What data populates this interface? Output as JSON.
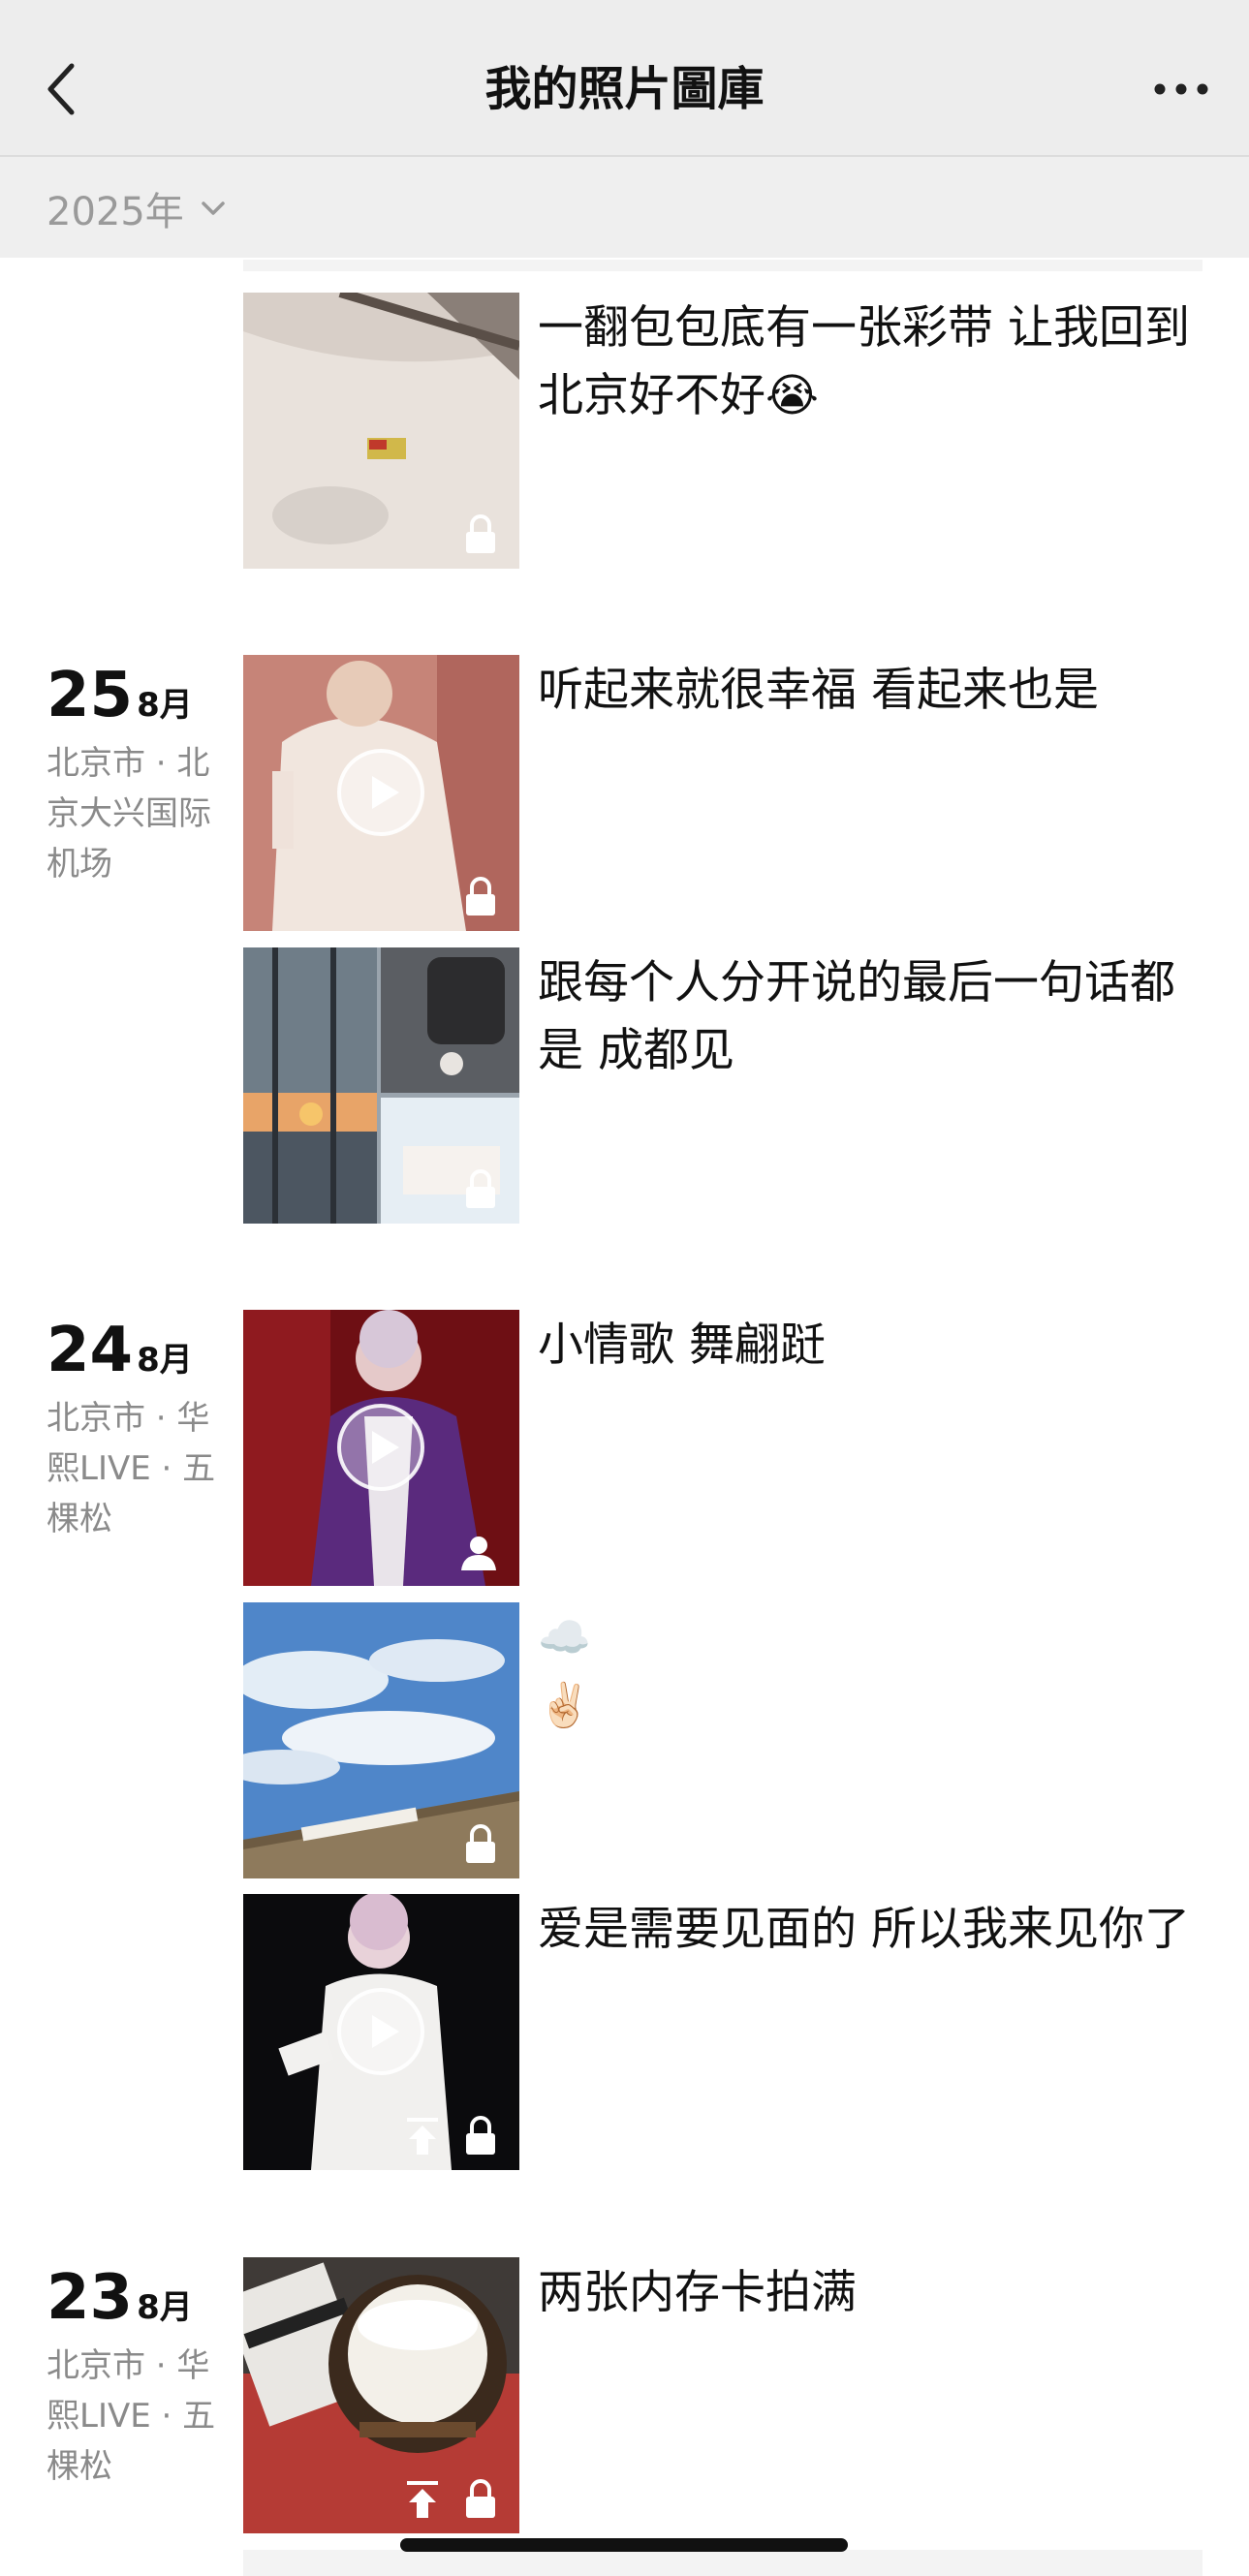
{
  "header": {
    "title": "我的照片圖庫"
  },
  "filter": {
    "year_label": "2025年"
  },
  "groups": [
    {
      "posts": [
        {
          "caption": "一翻包包底有一张彩带 让我回到北京好不好😭"
        }
      ]
    },
    {
      "day": "25",
      "month": "8月",
      "location": "北京市 · 北京大兴国际机场",
      "posts": [
        {
          "caption": "听起来就很幸福 看起来也是"
        },
        {
          "caption": "跟每个人分开说的最后一句话都是 成都见"
        }
      ]
    },
    {
      "day": "24",
      "month": "8月",
      "location": "北京市 · 华熙LIVE · 五棵松",
      "posts": [
        {
          "caption": "小情歌 舞翩跹"
        },
        {
          "caption": "☁️\n✌🏻"
        },
        {
          "caption": "爱是需要见面的 所以我来见你了"
        }
      ]
    },
    {
      "day": "23",
      "month": "8月",
      "location": "北京市 · 华熙LIVE · 五棵松",
      "posts": [
        {
          "caption": "两张内存卡拍满"
        }
      ]
    }
  ],
  "icons": {
    "back": "chevron-left-icon",
    "more": "more-icon",
    "dropdown": "chevron-down-icon",
    "play": "play-icon",
    "lock": "lock-icon",
    "person": "person-icon",
    "upload": "upload-icon"
  }
}
